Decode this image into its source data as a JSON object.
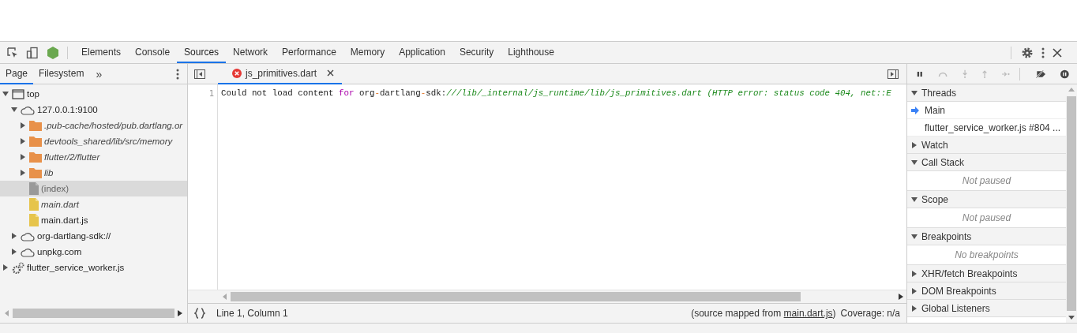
{
  "toolbar": {
    "tabs": [
      {
        "label": "Elements",
        "selected": false
      },
      {
        "label": "Console",
        "selected": false
      },
      {
        "label": "Sources",
        "selected": true
      },
      {
        "label": "Network",
        "selected": false
      },
      {
        "label": "Performance",
        "selected": false
      },
      {
        "label": "Memory",
        "selected": false
      },
      {
        "label": "Application",
        "selected": false
      },
      {
        "label": "Security",
        "selected": false
      },
      {
        "label": "Lighthouse",
        "selected": false
      }
    ]
  },
  "navigator": {
    "tabs": [
      {
        "label": "Page",
        "selected": true
      },
      {
        "label": "Filesystem",
        "selected": false
      }
    ],
    "more": "»",
    "tree": [
      {
        "label": "top",
        "kind": "frame",
        "expanded": true,
        "selected": false,
        "children": [
          {
            "label": "127.0.0.1:9100",
            "kind": "domain",
            "expanded": true,
            "selected": false,
            "children": [
              {
                "label": ".pub-cache/hosted/pub.dartlang.or",
                "kind": "folder",
                "italic": true,
                "expanded": false,
                "selected": false
              },
              {
                "label": "devtools_shared/lib/src/memory",
                "kind": "folder",
                "italic": true,
                "expanded": false,
                "selected": false
              },
              {
                "label": "flutter/2/flutter",
                "kind": "folder",
                "italic": true,
                "expanded": false,
                "selected": false
              },
              {
                "label": "lib",
                "kind": "folder",
                "italic": true,
                "expanded": false,
                "selected": false
              },
              {
                "label": "(index)",
                "kind": "document",
                "italic": false,
                "selected": true
              },
              {
                "label": "main.dart",
                "kind": "script",
                "italic": true,
                "selected": false
              },
              {
                "label": "main.dart.js",
                "kind": "script",
                "italic": false,
                "selected": false
              }
            ]
          },
          {
            "label": "org-dartlang-sdk://",
            "kind": "domain",
            "expanded": false,
            "selected": false
          },
          {
            "label": "unpkg.com",
            "kind": "domain",
            "expanded": false,
            "selected": false
          }
        ]
      },
      {
        "label": "flutter_service_worker.js",
        "kind": "worker",
        "expanded": false,
        "selected": false
      }
    ]
  },
  "editor": {
    "tabs": [
      {
        "label": "js_primitives.dart",
        "error": true,
        "selected": true
      }
    ],
    "lines": [
      {
        "number": "1",
        "tokens": [
          {
            "text": "Could not load content ",
            "kind": "plain"
          },
          {
            "text": "for",
            "kind": "keyword"
          },
          {
            "text": " org",
            "kind": "plain"
          },
          {
            "text": "-",
            "kind": "operator"
          },
          {
            "text": "dartlang",
            "kind": "plain"
          },
          {
            "text": "-",
            "kind": "operator"
          },
          {
            "text": "sdk:",
            "kind": "plain"
          },
          {
            "text": "///lib/_internal/js_runtime/lib/js_primitives.dart (HTTP error: status code 404, net::E",
            "kind": "comment"
          }
        ]
      }
    ],
    "status": {
      "position": "Line 1, Column 1",
      "mapped_prefix": "(source mapped from ",
      "mapped_link": "main.dart.js",
      "mapped_suffix": ")",
      "coverage": "Coverage: n/a"
    }
  },
  "debugger": {
    "sections": [
      {
        "title": "Threads",
        "expanded": true,
        "threads": [
          {
            "label": "Main",
            "selected": true
          },
          {
            "label": "flutter_service_worker.js #804 ...",
            "selected": false
          }
        ]
      },
      {
        "title": "Watch",
        "expanded": false
      },
      {
        "title": "Call Stack",
        "expanded": true,
        "message": "Not paused"
      },
      {
        "title": "Scope",
        "expanded": true,
        "message": "Not paused"
      },
      {
        "title": "Breakpoints",
        "expanded": true,
        "message": "No breakpoints"
      },
      {
        "title": "XHR/fetch Breakpoints",
        "expanded": false
      },
      {
        "title": "DOM Breakpoints",
        "expanded": false
      },
      {
        "title": "Global Listeners",
        "expanded": false
      }
    ]
  }
}
